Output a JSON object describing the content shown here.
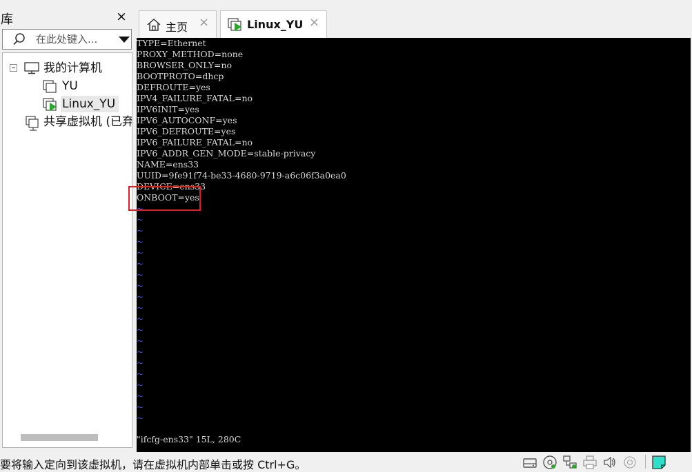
{
  "library": {
    "title": "库",
    "close_symbol": "×",
    "search": {
      "placeholder": "在此处键入..."
    },
    "tree": {
      "root_label": "我的计算机",
      "vms": [
        {
          "label": "YU",
          "icon": "vm-icon",
          "selected": false
        },
        {
          "label": "Linux_YU",
          "icon": "vm-running-icon",
          "selected": true
        }
      ],
      "shared_label": "共享虚拟机 (已弃用)"
    }
  },
  "tabs": [
    {
      "label": "主页",
      "icon": "home-icon",
      "active": false,
      "close_symbol": "×"
    },
    {
      "label": "Linux_YU",
      "icon": "vm-running-icon",
      "active": true,
      "close_symbol": "×"
    }
  ],
  "console": {
    "lines": [
      "TYPE=Ethernet",
      "PROXY_METHOD=none",
      "BROWSER_ONLY=no",
      "BOOTPROTO=dhcp",
      "DEFROUTE=yes",
      "IPV4_FAILURE_FATAL=no",
      "IPV6INIT=yes",
      "IPV6_AUTOCONF=yes",
      "IPV6_DEFROUTE=yes",
      "IPV6_FAILURE_FATAL=no",
      "IPV6_ADDR_GEN_MODE=stable-privacy",
      "NAME=ens33",
      "UUID=9fe91f74-be33-4680-9719-a6c06f3a0ea0",
      "DEVICE=ens33",
      "ONBOOT=yes"
    ],
    "tilde_char": "~",
    "tilde_count": 20,
    "status_line": "\"ifcfg-ens33\" 15L, 280C",
    "highlighted_line": "ONBOOT=yes",
    "text_color": "#d8d8d8",
    "tilde_color": "#4a5cff",
    "highlight_color": "#e02020"
  },
  "statusbar": {
    "message": "要将输入定向到该虚拟机，请在虚拟机内部单击或按 Ctrl+G。",
    "icons": [
      "hard-disk-icon",
      "cd-dvd-icon",
      "network-adapter-icon",
      "printer-icon",
      "sound-card-icon",
      "usb-icon",
      "message-log-icon"
    ]
  }
}
